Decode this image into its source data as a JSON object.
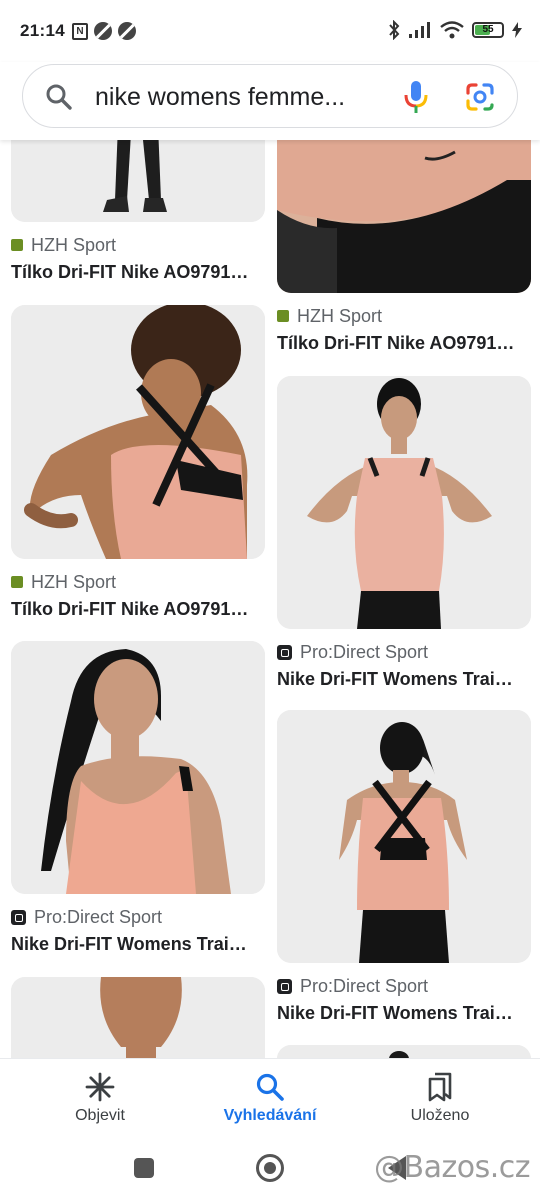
{
  "status_bar": {
    "time": "21:14",
    "battery_level": "55",
    "battery_color": "#4caf50",
    "icons": [
      "nfc-icon",
      "dnd-icon",
      "dnd-icon",
      "bluetooth-icon",
      "signal-icon",
      "wifi-icon",
      "battery-icon",
      "charging-icon"
    ]
  },
  "search": {
    "query": "nike womens femme...",
    "icons": [
      "search-icon",
      "mic-icon",
      "google-lens-icon"
    ]
  },
  "results": [
    {
      "source": "HZH Sport",
      "title": "Tílko Dri-FIT Nike AO9791…",
      "favicon": "hzh-favicon"
    },
    {
      "source": "HZH Sport",
      "title": "Tílko Dri-FIT Nike AO9791…",
      "favicon": "hzh-favicon"
    },
    {
      "source": "HZH Sport",
      "title": "Tílko Dri-FIT Nike AO9791…",
      "favicon": "hzh-favicon"
    },
    {
      "source": "Pro:Direct Sport",
      "title": "Nike Dri-FIT Womens Trai…",
      "favicon": "pro-direct-favicon"
    },
    {
      "source": "Pro:Direct Sport",
      "title": "Nike Dri-FIT Womens Trai…",
      "favicon": "pro-direct-favicon"
    },
    {
      "source": "Pro:Direct Sport",
      "title": "Nike Dri-FIT Womens Trai…",
      "favicon": "pro-direct-favicon"
    }
  ],
  "bottom_nav": {
    "items": [
      {
        "label": "Objevit",
        "icon": "asterisk-icon"
      },
      {
        "label": "Vyhledávání",
        "icon": "search-icon",
        "active": true
      },
      {
        "label": "Uloženo",
        "icon": "bookmarks-icon"
      }
    ],
    "active_color": "#1a73e8"
  },
  "watermark": {
    "text": "@Bazos.cz"
  }
}
